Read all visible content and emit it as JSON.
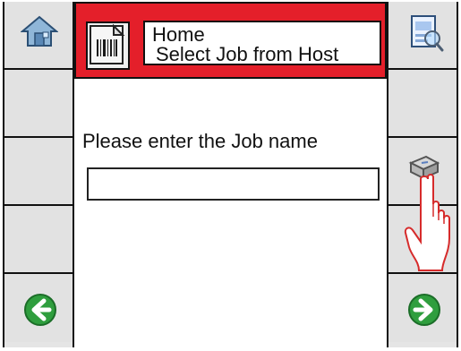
{
  "header": {
    "title_line1": "Home",
    "title_line2": "Select Job from Host",
    "accent_color": "#e41f2a"
  },
  "main": {
    "prompt": "Please enter the Job name",
    "job_input": {
      "value": "",
      "placeholder": ""
    }
  },
  "left_column": {
    "top_icon": "home-icon",
    "bottom_icon": "back-arrow-icon"
  },
  "right_column": {
    "top_icon": "document-search-icon",
    "keyboard_icon": "keyboard-key-icon",
    "bottom_icon": "forward-arrow-icon"
  },
  "colors": {
    "side_panel_bg": "#e2e2e2",
    "border": "#111111",
    "arrow_green": "#2f9e3e"
  }
}
